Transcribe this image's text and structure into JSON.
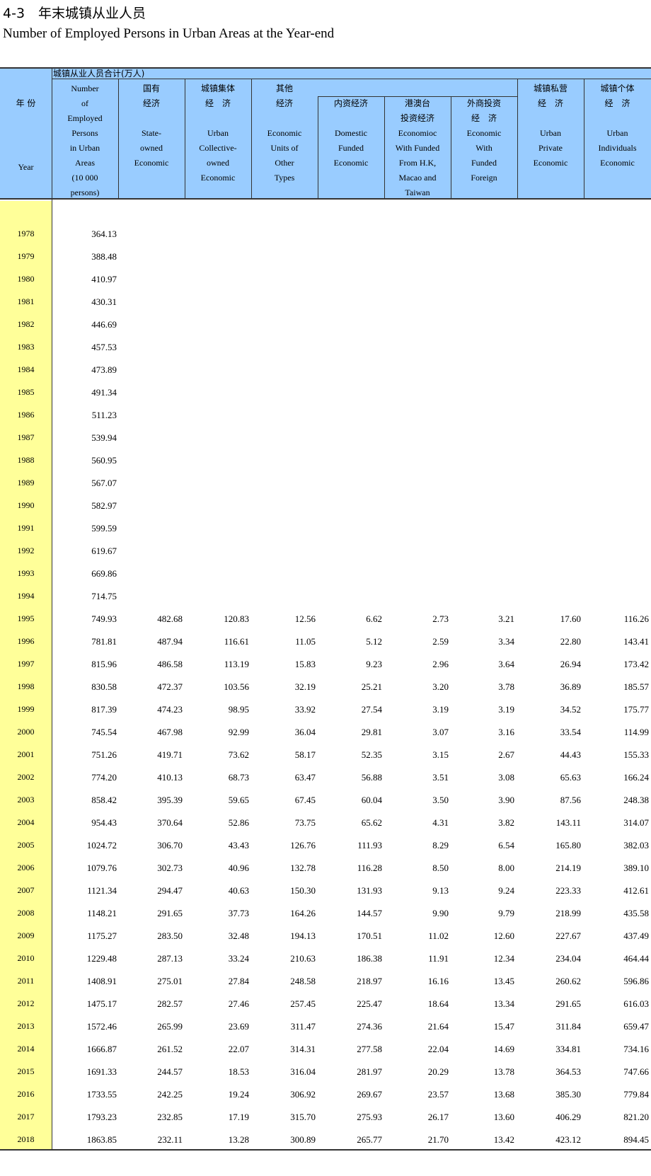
{
  "title_cn": "4-3　年末城镇从业人员",
  "title_en": "Number of Employed Persons in Urban Areas at the Year-end",
  "header": {
    "total_label": "城镇从业人员合计(万人)",
    "year_cn": "年 份",
    "year_en": "Year",
    "col1_en": "Number\nof\nEmployed\nPersons\nin Urban\nAreas\n(10 000\npersons)",
    "col2_cn": "国有\n经济",
    "col2_en": "State-\nowned\nEconomic",
    "col3_cn": "城镇集体\n经　济",
    "col3_en": "Urban\nCollective-\nowned\nEconomic",
    "col4_cn": "其他\n经济",
    "col4_en": "Economic\nUnits of\nOther\nTypes",
    "col5_cn": "内资经济",
    "col5_en": "Domestic\nFunded\nEconomic",
    "col6_cn": "港澳台\n投资经济",
    "col6_en": "Economioc\nWith Funded\nFrom H.K,\nMacao and\nTaiwan",
    "col7_cn": "外商投资\n经　济",
    "col7_en": "Economic\nWith\nFunded\nForeign",
    "col8_cn": "城镇私营\n经　济",
    "col8_en": "Urban\nPrivate\nEconomic",
    "col9_cn": "城镇个体\n经　济",
    "col9_en": "Urban\nIndividuals\nEconomic"
  },
  "rows": [
    {
      "year": "1978",
      "v": [
        "364.13",
        "",
        "",
        "",
        "",
        "",
        "",
        "",
        ""
      ]
    },
    {
      "year": "1979",
      "v": [
        "388.48",
        "",
        "",
        "",
        "",
        "",
        "",
        "",
        ""
      ]
    },
    {
      "year": "1980",
      "v": [
        "410.97",
        "",
        "",
        "",
        "",
        "",
        "",
        "",
        ""
      ]
    },
    {
      "year": "1981",
      "v": [
        "430.31",
        "",
        "",
        "",
        "",
        "",
        "",
        "",
        ""
      ]
    },
    {
      "year": "1982",
      "v": [
        "446.69",
        "",
        "",
        "",
        "",
        "",
        "",
        "",
        ""
      ]
    },
    {
      "year": "1983",
      "v": [
        "457.53",
        "",
        "",
        "",
        "",
        "",
        "",
        "",
        ""
      ]
    },
    {
      "year": "1984",
      "v": [
        "473.89",
        "",
        "",
        "",
        "",
        "",
        "",
        "",
        ""
      ]
    },
    {
      "year": "1985",
      "v": [
        "491.34",
        "",
        "",
        "",
        "",
        "",
        "",
        "",
        ""
      ]
    },
    {
      "year": "1986",
      "v": [
        "511.23",
        "",
        "",
        "",
        "",
        "",
        "",
        "",
        ""
      ]
    },
    {
      "year": "1987",
      "v": [
        "539.94",
        "",
        "",
        "",
        "",
        "",
        "",
        "",
        ""
      ]
    },
    {
      "year": "1988",
      "v": [
        "560.95",
        "",
        "",
        "",
        "",
        "",
        "",
        "",
        ""
      ]
    },
    {
      "year": "1989",
      "v": [
        "567.07",
        "",
        "",
        "",
        "",
        "",
        "",
        "",
        ""
      ]
    },
    {
      "year": "1990",
      "v": [
        "582.97",
        "",
        "",
        "",
        "",
        "",
        "",
        "",
        ""
      ]
    },
    {
      "year": "1991",
      "v": [
        "599.59",
        "",
        "",
        "",
        "",
        "",
        "",
        "",
        ""
      ]
    },
    {
      "year": "1992",
      "v": [
        "619.67",
        "",
        "",
        "",
        "",
        "",
        "",
        "",
        ""
      ]
    },
    {
      "year": "1993",
      "v": [
        "669.86",
        "",
        "",
        "",
        "",
        "",
        "",
        "",
        ""
      ]
    },
    {
      "year": "1994",
      "v": [
        "714.75",
        "",
        "",
        "",
        "",
        "",
        "",
        "",
        ""
      ]
    },
    {
      "year": "1995",
      "v": [
        "749.93",
        "482.68",
        "120.83",
        "12.56",
        "6.62",
        "2.73",
        "3.21",
        "17.60",
        "116.26"
      ]
    },
    {
      "year": "1996",
      "v": [
        "781.81",
        "487.94",
        "116.61",
        "11.05",
        "5.12",
        "2.59",
        "3.34",
        "22.80",
        "143.41"
      ]
    },
    {
      "year": "1997",
      "v": [
        "815.96",
        "486.58",
        "113.19",
        "15.83",
        "9.23",
        "2.96",
        "3.64",
        "26.94",
        "173.42"
      ]
    },
    {
      "year": "1998",
      "v": [
        "830.58",
        "472.37",
        "103.56",
        "32.19",
        "25.21",
        "3.20",
        "3.78",
        "36.89",
        "185.57"
      ]
    },
    {
      "year": "1999",
      "v": [
        "817.39",
        "474.23",
        "98.95",
        "33.92",
        "27.54",
        "3.19",
        "3.19",
        "34.52",
        "175.77"
      ]
    },
    {
      "year": "2000",
      "v": [
        "745.54",
        "467.98",
        "92.99",
        "36.04",
        "29.81",
        "3.07",
        "3.16",
        "33.54",
        "114.99"
      ]
    },
    {
      "year": "2001",
      "v": [
        "751.26",
        "419.71",
        "73.62",
        "58.17",
        "52.35",
        "3.15",
        "2.67",
        "44.43",
        "155.33"
      ]
    },
    {
      "year": "2002",
      "v": [
        "774.20",
        "410.13",
        "68.73",
        "63.47",
        "56.88",
        "3.51",
        "3.08",
        "65.63",
        "166.24"
      ]
    },
    {
      "year": "2003",
      "v": [
        "858.42",
        "395.39",
        "59.65",
        "67.45",
        "60.04",
        "3.50",
        "3.90",
        "87.56",
        "248.38"
      ]
    },
    {
      "year": "2004",
      "v": [
        "954.43",
        "370.64",
        "52.86",
        "73.75",
        "65.62",
        "4.31",
        "3.82",
        "143.11",
        "314.07"
      ]
    },
    {
      "year": "2005",
      "v": [
        "1024.72",
        "306.70",
        "43.43",
        "126.76",
        "111.93",
        "8.29",
        "6.54",
        "165.80",
        "382.03"
      ]
    },
    {
      "year": "2006",
      "v": [
        "1079.76",
        "302.73",
        "40.96",
        "132.78",
        "116.28",
        "8.50",
        "8.00",
        "214.19",
        "389.10"
      ]
    },
    {
      "year": "2007",
      "v": [
        "1121.34",
        "294.47",
        "40.63",
        "150.30",
        "131.93",
        "9.13",
        "9.24",
        "223.33",
        "412.61"
      ]
    },
    {
      "year": "2008",
      "v": [
        "1148.21",
        "291.65",
        "37.73",
        "164.26",
        "144.57",
        "9.90",
        "9.79",
        "218.99",
        "435.58"
      ]
    },
    {
      "year": "2009",
      "v": [
        "1175.27",
        "283.50",
        "32.48",
        "194.13",
        "170.51",
        "11.02",
        "12.60",
        "227.67",
        "437.49"
      ]
    },
    {
      "year": "2010",
      "v": [
        "1229.48",
        "287.13",
        "33.24",
        "210.63",
        "186.38",
        "11.91",
        "12.34",
        "234.04",
        "464.44"
      ]
    },
    {
      "year": "2011",
      "v": [
        "1408.91",
        "275.01",
        "27.84",
        "248.58",
        "218.97",
        "16.16",
        "13.45",
        "260.62",
        "596.86"
      ]
    },
    {
      "year": "2012",
      "v": [
        "1475.17",
        "282.57",
        "27.46",
        "257.45",
        "225.47",
        "18.64",
        "13.34",
        "291.65",
        "616.03"
      ]
    },
    {
      "year": "2013",
      "v": [
        "1572.46",
        "265.99",
        "23.69",
        "311.47",
        "274.36",
        "21.64",
        "15.47",
        "311.84",
        "659.47"
      ]
    },
    {
      "year": "2014",
      "v": [
        "1666.87",
        "261.52",
        "22.07",
        "314.31",
        "277.58",
        "22.04",
        "14.69",
        "334.81",
        "734.16"
      ]
    },
    {
      "year": "2015",
      "v": [
        "1691.33",
        "244.57",
        "18.53",
        "316.04",
        "281.97",
        "20.29",
        "13.78",
        "364.53",
        "747.66"
      ]
    },
    {
      "year": "2016",
      "v": [
        "1733.55",
        "242.25",
        "19.24",
        "306.92",
        "269.67",
        "23.57",
        "13.68",
        "385.30",
        "779.84"
      ]
    },
    {
      "year": "2017",
      "v": [
        "1793.23",
        "232.85",
        "17.19",
        "315.70",
        "275.93",
        "26.17",
        "13.60",
        "406.29",
        "821.20"
      ]
    },
    {
      "year": "2018",
      "v": [
        "1863.85",
        "232.11",
        "13.28",
        "300.89",
        "265.77",
        "21.70",
        "13.42",
        "423.12",
        "894.45"
      ]
    }
  ]
}
